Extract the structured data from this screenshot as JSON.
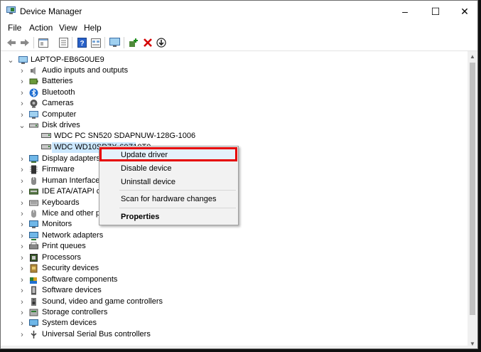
{
  "window": {
    "title": "Device Manager",
    "controls": {
      "minimize": "–",
      "maximize": "☐",
      "close": "✕"
    }
  },
  "menu": [
    "File",
    "Action",
    "View",
    "Help"
  ],
  "toolbar": [
    "back",
    "forward",
    "properties-sheet",
    "list-view",
    "help",
    "details",
    "scan-monitor",
    "update-driver",
    "uninstall",
    "download"
  ],
  "tree": {
    "root": "LAPTOP-EB6G0UE9",
    "categories": [
      {
        "label": "Audio inputs and outputs",
        "icon": "speaker-icon"
      },
      {
        "label": "Batteries",
        "icon": "battery-icon"
      },
      {
        "label": "Bluetooth",
        "icon": "bluetooth-icon"
      },
      {
        "label": "Cameras",
        "icon": "camera-icon"
      },
      {
        "label": "Computer",
        "icon": "computer-icon"
      },
      {
        "label": "Disk drives",
        "icon": "disk-icon",
        "expanded": true
      },
      {
        "label": "Display adapters",
        "icon": "display-icon"
      },
      {
        "label": "Firmware",
        "icon": "chip-icon"
      },
      {
        "label": "Human Interface D",
        "icon": "hid-icon"
      },
      {
        "label": "IDE ATA/ATAPI cont",
        "icon": "ide-icon"
      },
      {
        "label": "Keyboards",
        "icon": "keyboard-icon"
      },
      {
        "label": "Mice and other po",
        "icon": "mouse-icon"
      },
      {
        "label": "Monitors",
        "icon": "monitor-icon"
      },
      {
        "label": "Network adapters",
        "icon": "network-icon"
      },
      {
        "label": "Print queues",
        "icon": "printer-icon"
      },
      {
        "label": "Processors",
        "icon": "processor-icon"
      },
      {
        "label": "Security devices",
        "icon": "security-icon"
      },
      {
        "label": "Software components",
        "icon": "puzzle-icon"
      },
      {
        "label": "Software devices",
        "icon": "software-device-icon"
      },
      {
        "label": "Sound, video and game controllers",
        "icon": "sound-icon"
      },
      {
        "label": "Storage controllers",
        "icon": "storage-icon"
      },
      {
        "label": "System devices",
        "icon": "system-icon"
      },
      {
        "label": "Universal Serial Bus controllers",
        "icon": "usb-icon"
      }
    ],
    "disk_children": [
      "WDC PC SN520 SDAPNUW-128G-1006",
      "WDC WD10SPZX-60Z10T0"
    ]
  },
  "context_menu": {
    "items": [
      "Update driver",
      "Disable device",
      "Uninstall device",
      "Scan for hardware changes",
      "Properties"
    ]
  },
  "colors": {
    "selection": "#cce8ff",
    "highlight": "#e60000"
  }
}
